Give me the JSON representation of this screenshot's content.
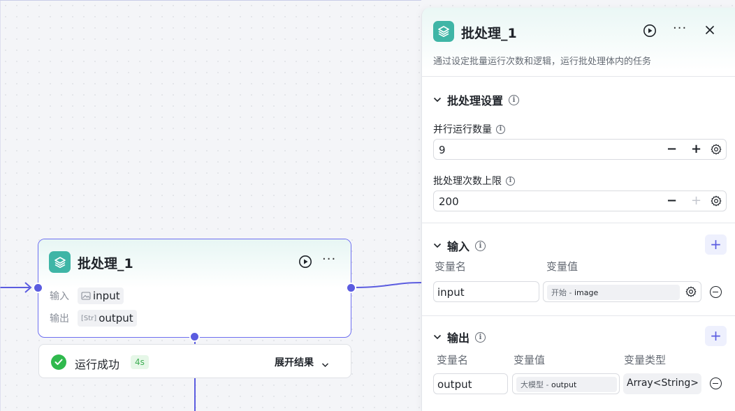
{
  "colors": {
    "accent": "#5b5ce0",
    "node_icon_bg": "#3fb5a6",
    "success": "#2fb94d"
  },
  "node": {
    "icon": "layers-icon",
    "title": "批处理_1",
    "inputs_label": "输入",
    "outputs_label": "输出",
    "input_type_icon": "image-type-icon",
    "input_name": "input",
    "output_type_tag": "[Str]",
    "output_name": "output"
  },
  "status": {
    "text": "运行成功",
    "duration": "4s",
    "expand_label": "展开结果"
  },
  "panel": {
    "title": "批处理_1",
    "description": "通过设定批量运行次数和逻辑，运行批处理体内的任务",
    "settings": {
      "title": "批处理设置",
      "parallel_label": "并行运行数量",
      "parallel_value": "9",
      "limit_label": "批处理次数上限",
      "limit_value": "200"
    },
    "input": {
      "title": "输入",
      "col_name": "变量名",
      "col_value": "变量值",
      "row_name": "input",
      "row_ref_source": "开始",
      "row_ref_sep": " - ",
      "row_ref_var": "image"
    },
    "output": {
      "title": "输出",
      "col_name": "变量名",
      "col_value": "变量值",
      "col_type": "变量类型",
      "row_name": "output",
      "row_ref_source": "大模型",
      "row_ref_sep": " - ",
      "row_ref_var": "output",
      "row_type": "Array<String>"
    }
  }
}
